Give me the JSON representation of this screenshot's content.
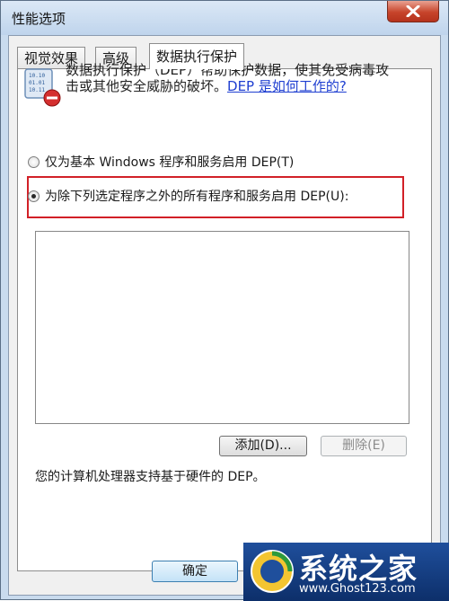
{
  "window": {
    "title": "性能选项"
  },
  "tabs": [
    {
      "label": "视觉效果",
      "active": false
    },
    {
      "label": "高级",
      "active": false
    },
    {
      "label": "数据执行保护",
      "active": true
    }
  ],
  "dep": {
    "description": "数据执行保护（DEP）帮助保护数据，使其免受病毒攻击或其他安全威胁的破坏。",
    "link_text": "DEP 是如何工作的?",
    "option_basic": "仅为基本 Windows 程序和服务启用 DEP(T)",
    "option_all": "为除下列选定程序之外的所有程序和服务启用 DEP(U):",
    "selected_option": "option_all",
    "add_button": "添加(D)...",
    "remove_button": "删除(E)",
    "support_text": "您的计算机处理器支持基于硬件的 DEP。"
  },
  "footer": {
    "ok_button": "确定"
  },
  "watermark": {
    "brand": "系统之家",
    "url": "www.Ghost123.com"
  },
  "colors": {
    "highlight_border": "#d22027",
    "link": "#1f3fd1",
    "watermark_bg": "#1f4f9c"
  }
}
